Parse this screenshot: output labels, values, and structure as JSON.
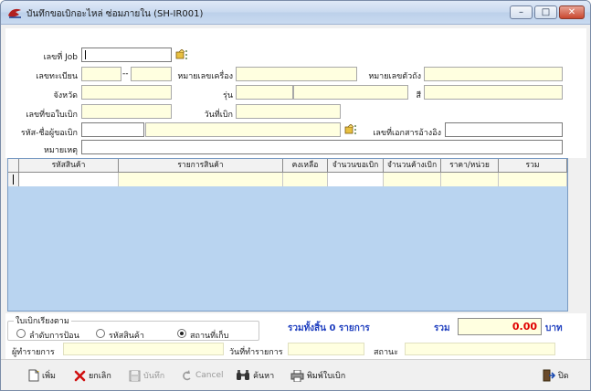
{
  "window": {
    "title": "บันทึกขอเบิกอะไหล่ ซ่อมภายใน (SH-IR001)",
    "buttons": {
      "minimize": "–",
      "maximize": "□",
      "close": "✕"
    }
  },
  "form": {
    "job_no_label": "เลขที่ Job",
    "registration_label": "เลขทะเบียน",
    "registration_dash": "--",
    "engine_no_label": "หมายเลขเครื่อง",
    "chassis_no_label": "หมายเลขตัวถัง",
    "province_label": "จังหวัด",
    "model_label": "รุ่น",
    "color_label": "สี",
    "request_no_label": "เลขที่ขอใบเบิก",
    "request_date_label": "วันที่เบิก",
    "requester_label": "รหัส-ชื่อผู้ขอเบิก",
    "reference_doc_label": "เลขที่เอกสารอ้างอิง",
    "remark_label": "หมายเหตุ",
    "job_no_value": "",
    "registration_value_1": "",
    "registration_value_2": "",
    "engine_no_value": "",
    "chassis_no_value": "",
    "province_value": "",
    "model_code_value": "",
    "model_name_value": "",
    "color_value": "",
    "request_no_value": "",
    "request_date_value": "",
    "requester_code_value": "",
    "requester_name_value": "",
    "reference_doc_value": "",
    "remark_value": ""
  },
  "grid": {
    "columns": [
      "รหัสสินค้า",
      "รายการสินค้า",
      "คงเหลือ",
      "จำนวนขอเบิก",
      "จำนวนค้างเบิก",
      "ราคา/หน่วย",
      "รวม"
    ]
  },
  "sort_group": {
    "label": "ใบเบิกเรียงตาม",
    "options": [
      "ลำดับการป้อน",
      "รหัสสินค้า",
      "สถานที่เก็บ"
    ],
    "selected": "สถานที่เก็บ"
  },
  "summary": {
    "total_items_text": "รวมทั้งสิ้น 0 รายการ",
    "total_label": "รวม",
    "total_value": "0.00",
    "currency": "บาท"
  },
  "footer": {
    "recorder_label": "ผู้ทำรายการ",
    "record_date_label": "วันที่ทำรายการ",
    "status_label": "สถานะ",
    "recorder_value": "",
    "record_date_value": "",
    "status_value": ""
  },
  "toolbar": {
    "new_label": "เพิ่ม",
    "cancel_label": "ยกเลิก",
    "save_label": "บันทึก",
    "undo_label": "Cancel",
    "search_label": "ค้นหา",
    "print_label": "พิมพ์ใบเบิก",
    "close_label": "ปิด"
  },
  "colors": {
    "input_bg": "#ffffe0",
    "grid_bg": "#b9d4f0",
    "summary_text": "#1f3fbf",
    "total_text": "#e00000"
  }
}
